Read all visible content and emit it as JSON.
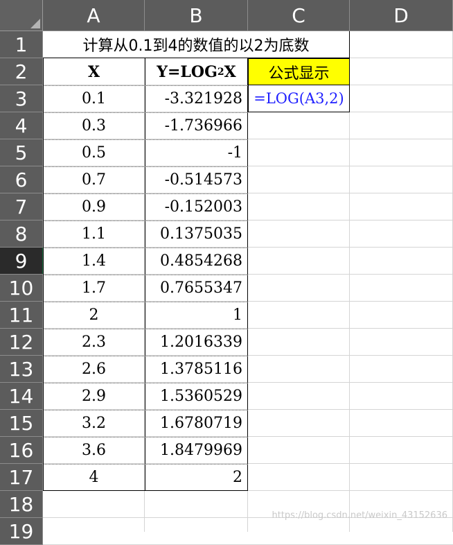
{
  "columns": [
    "A",
    "B",
    "C",
    "D"
  ],
  "rows": [
    "1",
    "2",
    "3",
    "4",
    "5",
    "6",
    "7",
    "8",
    "9",
    "10",
    "11",
    "12",
    "13",
    "14",
    "15",
    "16",
    "17",
    "18",
    "19"
  ],
  "selected_row": "9",
  "title": "计算从0.1到4的数值的以2为底数",
  "header": {
    "x_label": "X",
    "y_label_pre": "Y=LOG",
    "y_label_sub": "2",
    "y_label_post": "X",
    "formula_label": "公式显示"
  },
  "formula_text": "=LOG(A3,2)",
  "table": [
    {
      "x": "0.1",
      "y": "-3.321928"
    },
    {
      "x": "0.3",
      "y": "-1.736966"
    },
    {
      "x": "0.5",
      "y": "-1"
    },
    {
      "x": "0.7",
      "y": "-0.514573"
    },
    {
      "x": "0.9",
      "y": "-0.152003"
    },
    {
      "x": "1.1",
      "y": "0.1375035"
    },
    {
      "x": "1.4",
      "y": "0.4854268"
    },
    {
      "x": "1.7",
      "y": "0.7655347"
    },
    {
      "x": "2",
      "y": "1"
    },
    {
      "x": "2.3",
      "y": "1.2016339"
    },
    {
      "x": "2.6",
      "y": "1.3785116"
    },
    {
      "x": "2.9",
      "y": "1.5360529"
    },
    {
      "x": "3.2",
      "y": "1.6780719"
    },
    {
      "x": "3.6",
      "y": "1.8479969"
    },
    {
      "x": "4",
      "y": "2"
    }
  ],
  "watermark": "https://blog.csdn.net/weixin_43152636"
}
